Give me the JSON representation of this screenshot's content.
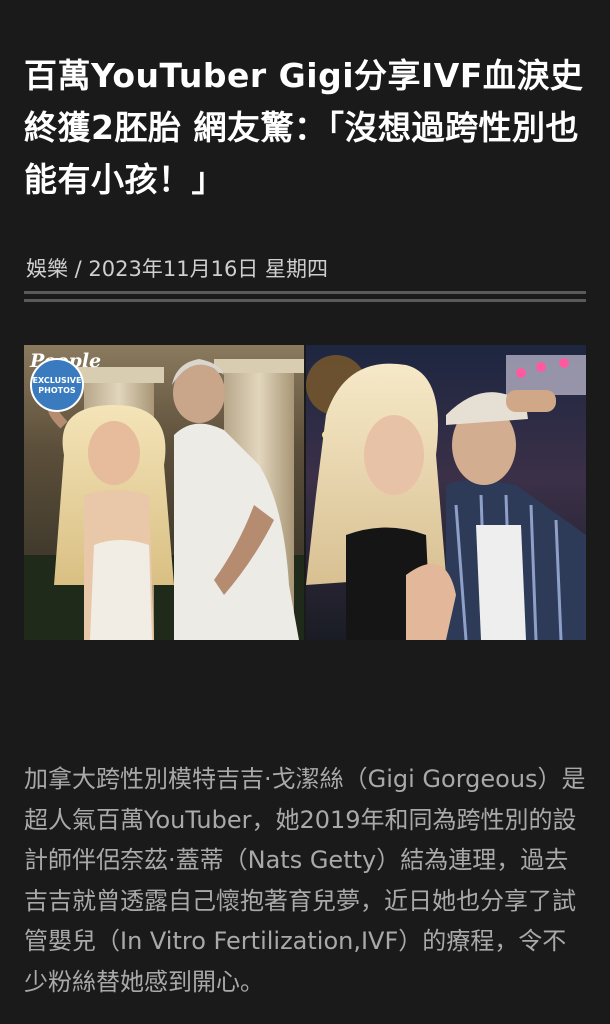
{
  "article": {
    "title": "百萬YouTuber Gigi分享IVF血淚史終獲2胚胎 網友驚：「沒想過跨性別也能有小孩！」",
    "meta": "娛樂 / 2023年11月16日 星期四",
    "photo_badge": {
      "brand": "People",
      "line1": "EXCLUSIVE",
      "line2": "PHOTOS"
    },
    "body": "加拿大跨性別模特吉吉·戈潔絲（Gigi Gorgeous）是超人氣百萬YouTuber，她2019年和同為跨性別的設計師伴侶奈茲·蓋蒂（Nats Getty）結為連理，過去吉吉就曾透露自己懷抱著育兒夢，近日她也分享了試管嬰兒（In Vitro Fertilization,IVF）的療程，令不少粉絲替她感到開心。"
  },
  "colors": {
    "background": "#1a1a1a",
    "title": "#ffffff",
    "meta": "#cfcfcf",
    "body": "#a9a9a9",
    "rule": "#5a5a5a",
    "badge": "#3a7bbf"
  }
}
